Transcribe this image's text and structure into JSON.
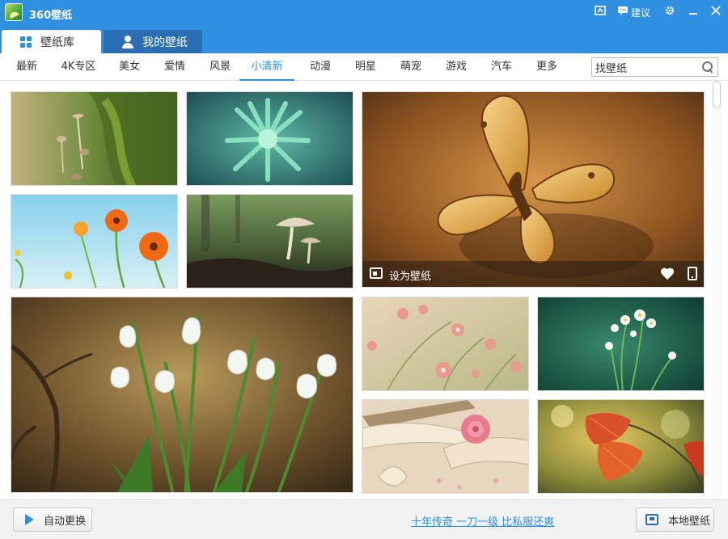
{
  "window": {
    "title": "360壁纸",
    "feedback_label": "建议"
  },
  "tabs": [
    {
      "label": "壁纸库",
      "icon": "grid-icon",
      "active": true
    },
    {
      "label": "我的壁纸",
      "icon": "user-icon",
      "active": false
    }
  ],
  "categories": [
    {
      "label": "最新"
    },
    {
      "label": "4K专区"
    },
    {
      "label": "美女"
    },
    {
      "label": "爱情"
    },
    {
      "label": "风景"
    },
    {
      "label": "小清新",
      "active": true
    },
    {
      "label": "动漫"
    },
    {
      "label": "明星"
    },
    {
      "label": "萌宠"
    },
    {
      "label": "游戏"
    },
    {
      "label": "汽车"
    },
    {
      "label": "更多"
    }
  ],
  "search": {
    "value": "找壁纸",
    "icon": "search-icon"
  },
  "wallpapers": [
    {
      "subject": "mushrooms-moss",
      "colors": [
        "#6f8f3a",
        "#2f4f1e",
        "#c9b48e"
      ]
    },
    {
      "subject": "green-succulent",
      "colors": [
        "#2e8f86",
        "#8fe0c2",
        "#1e4f4e"
      ]
    },
    {
      "subject": "butterfly",
      "colors": [
        "#b9772f",
        "#f2c56e",
        "#4a2e14"
      ],
      "featured": true
    },
    {
      "subject": "orange-flowers-sky",
      "colors": [
        "#8fd2ea",
        "#f07a20",
        "#5fa83e"
      ]
    },
    {
      "subject": "forest-mushroom",
      "colors": [
        "#5f7a4a",
        "#d9cfb8",
        "#2a2a1e"
      ]
    },
    {
      "subject": "snowdrops",
      "colors": [
        "#7e6a40",
        "#f4f4f4",
        "#3e6e2e"
      ]
    },
    {
      "subject": "pink-blossoms",
      "colors": [
        "#c9c79a",
        "#e89a8e",
        "#f6efe0"
      ]
    },
    {
      "subject": "white-wildflowers",
      "colors": [
        "#1e5a4a",
        "#f4f4f4",
        "#2f8f6e"
      ]
    },
    {
      "subject": "book-rose",
      "colors": [
        "#d9c4a8",
        "#e87a8e",
        "#a08e72"
      ]
    },
    {
      "subject": "autumn-leaves",
      "colors": [
        "#d9a42e",
        "#d9442a",
        "#4a5a2a"
      ]
    }
  ],
  "overlay": {
    "set_label": "设为壁纸"
  },
  "bottom": {
    "auto_change_label": "自动更换",
    "promo_text": "十年传奇 一刀一级 比私服还爽",
    "local_label": "本地壁纸"
  }
}
